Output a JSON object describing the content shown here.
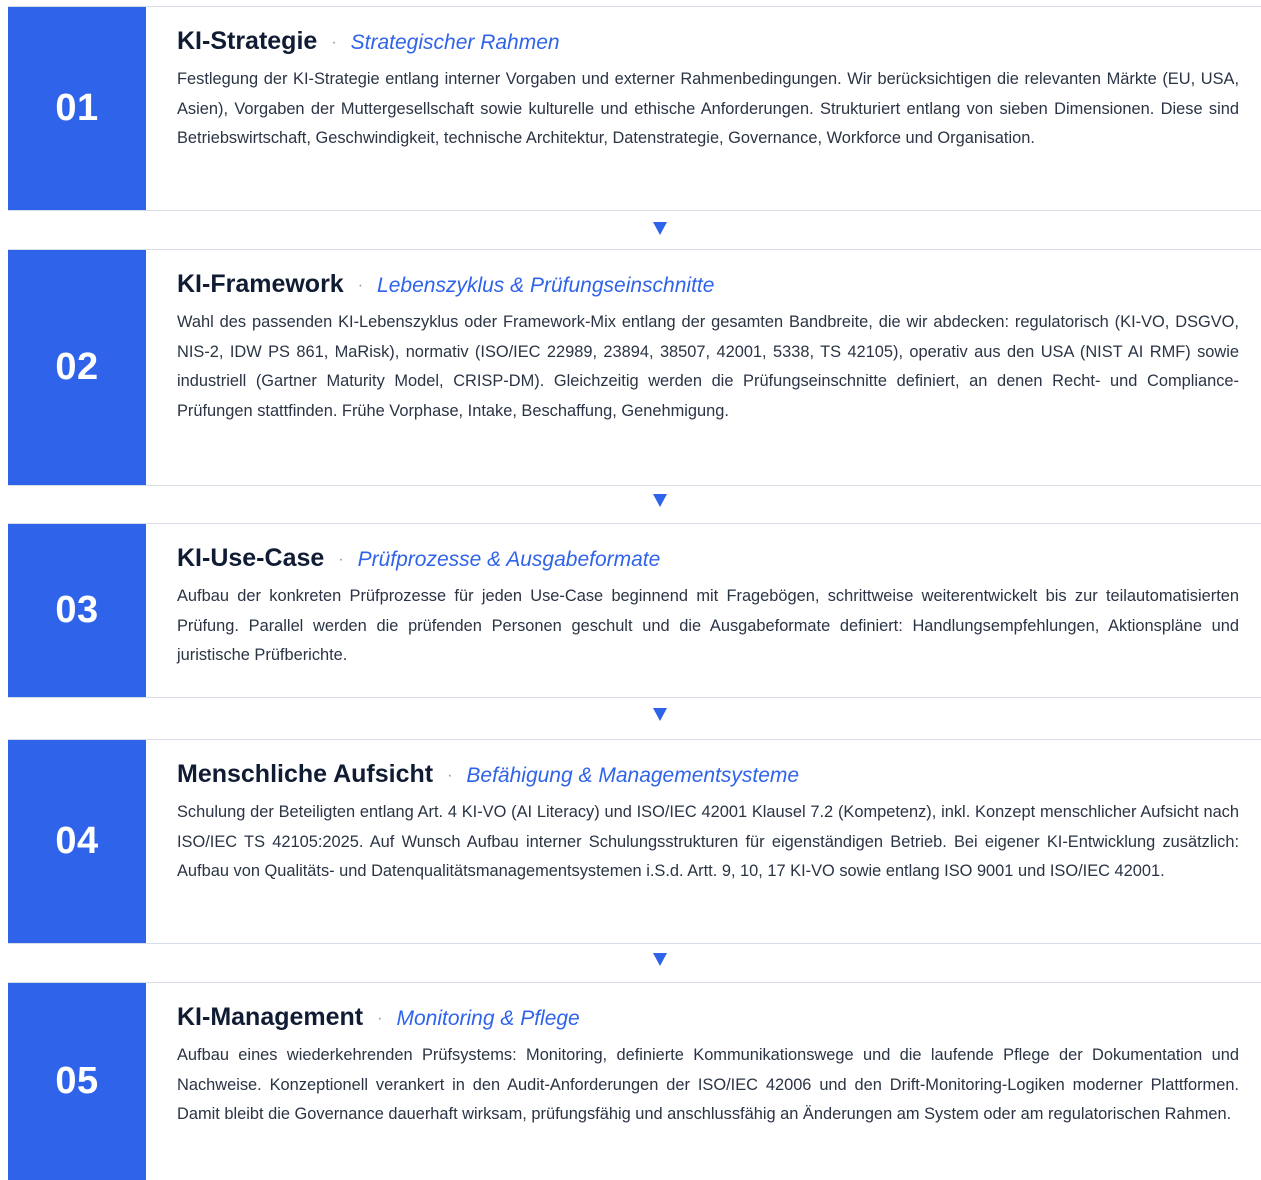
{
  "steps": [
    {
      "number": "01",
      "title": "KI-Strategie",
      "separator": "·",
      "subtitle": "Strategischer Rahmen",
      "text": "Festlegung der KI-Strategie entlang interner Vorgaben und externer Rahmenbedingungen. Wir berücksichtigen die relevanten Märkte (EU, USA, Asien), Vorgaben der Muttergesellschaft sowie kulturelle und ethische Anforderungen. Strukturiert entlang von sieben Dimensionen. Diese sind Betriebswirtschaft, Geschwindigkeit, technische Architektur, Datenstrategie, Governance, Workforce und Organisation."
    },
    {
      "number": "02",
      "title": "KI-Framework",
      "separator": "·",
      "subtitle": "Lebenszyklus & Prüfungseinschnitte",
      "text": "Wahl des passenden KI-Lebenszyklus oder Framework-Mix entlang der gesamten Bandbreite, die wir abdecken: regulatorisch (KI-VO, DSGVO, NIS-2, IDW PS 861, MaRisk), normativ (ISO/IEC 22989, 23894, 38507, 42001, 5338, TS 42105), operativ aus den USA (NIST AI RMF) sowie industriell (Gartner Maturity Model, CRISP-DM). Gleichzeitig werden die Prüfungseinschnitte definiert, an denen Recht- und Compliance-Prüfungen stattfinden. Frühe Vorphase, Intake, Beschaffung, Genehmigung."
    },
    {
      "number": "03",
      "title": "KI-Use-Case",
      "separator": "·",
      "subtitle": "Prüfprozesse & Ausgabeformate",
      "text": "Aufbau der konkreten Prüfprozesse für jeden Use-Case beginnend mit Fragebögen, schrittweise weiterentwickelt bis zur teilautomatisierten Prüfung. Parallel werden die prüfenden Personen geschult und die Ausgabeformate definiert: Handlungsempfehlungen, Aktionspläne und juristische Prüfberichte."
    },
    {
      "number": "04",
      "title": "Menschliche Aufsicht",
      "separator": "·",
      "subtitle": "Befähigung & Managementsysteme",
      "text": "Schulung der Beteiligten entlang Art. 4 KI-VO (AI Literacy) und ISO/IEC 42001 Klausel 7.2 (Kompetenz), inkl. Konzept menschlicher Aufsicht nach ISO/IEC TS 42105:2025. Auf Wunsch Aufbau interner Schulungsstrukturen für eigenständigen Betrieb. Bei eigener KI-Entwicklung zusätzlich: Aufbau von Qualitäts- und Datenqualitätsmanagementsystemen i.S.d. Artt. 9, 10, 17 KI-VO sowie entlang ISO 9001 und ISO/IEC 42001."
    },
    {
      "number": "05",
      "title": "KI-Management",
      "separator": "·",
      "subtitle": "Monitoring & Pflege",
      "text": "Aufbau eines wiederkehrenden Prüfsystems: Monitoring, definierte Kommunikationswege und die laufende Pflege der Dokumentation und Nachweise. Konzeptionell verankert in den Audit-Anforderungen der ISO/IEC 42006 und den Drift-Monitoring-Logiken moderner Plattformen. Damit bleibt die Governance dauerhaft wirksam, prüfungsfähig und anschlussfähig an Änderungen am System oder am regulatorischen Rahmen."
    }
  ],
  "colors": {
    "accent": "#2f63e9",
    "title": "#101c33",
    "text": "#2a3444",
    "separator": "#8a94a6",
    "divider": "#d7dee8"
  },
  "icons": {
    "connector": "down-triangle-icon"
  }
}
